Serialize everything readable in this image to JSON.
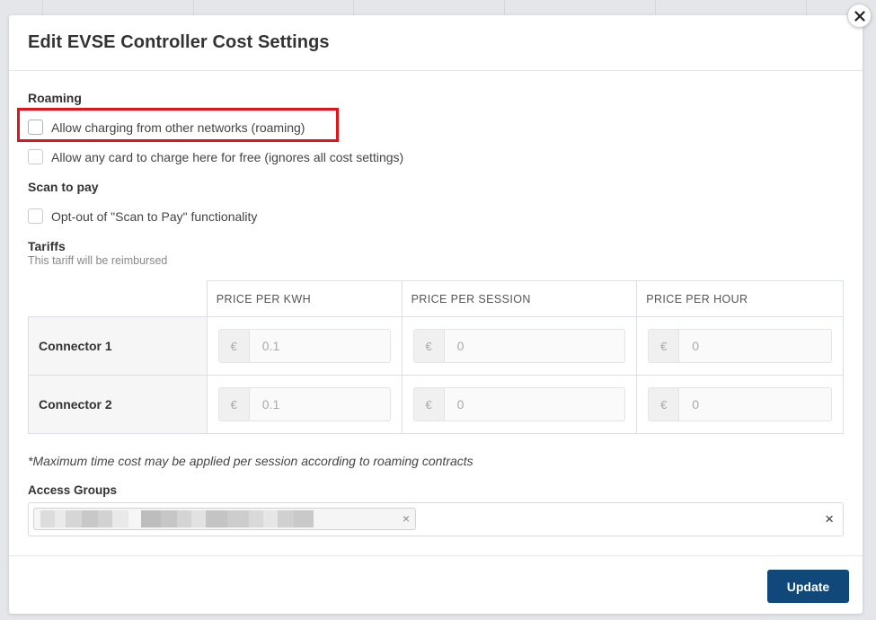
{
  "dialog": {
    "title": "Edit EVSE Controller Cost Settings",
    "close_icon": "close-icon"
  },
  "roaming": {
    "section_title": "Roaming",
    "allow_roaming_label": "Allow charging from other networks (roaming)",
    "allow_roaming_checked": false,
    "free_charging_label": "Allow any card to charge here for free (ignores all cost settings)",
    "free_charging_checked": false
  },
  "scan_to_pay": {
    "section_title": "Scan to pay",
    "opt_out_label": "Opt-out of \"Scan to Pay\" functionality",
    "opt_out_checked": false
  },
  "tariffs": {
    "section_title": "Tariffs",
    "subtitle": "This tariff will be reimbursed",
    "columns": [
      "PRICE PER KWH",
      "PRICE PER SESSION",
      "PRICE PER HOUR"
    ],
    "currency_symbol": "€",
    "rows": [
      {
        "label": "Connector 1",
        "kwh": "0.1",
        "session": "0",
        "hour": "0"
      },
      {
        "label": "Connector 2",
        "kwh": "0.1",
        "session": "0",
        "hour": "0"
      }
    ]
  },
  "note": "*Maximum time cost may be applied per session according to roaming contracts",
  "access_groups": {
    "label": "Access Groups",
    "tag_remove_symbol": "×",
    "clear_symbol": "×"
  },
  "footer": {
    "update_label": "Update"
  },
  "colors": {
    "primary_button": "#0f4879",
    "highlight_border": "#e0141a"
  }
}
